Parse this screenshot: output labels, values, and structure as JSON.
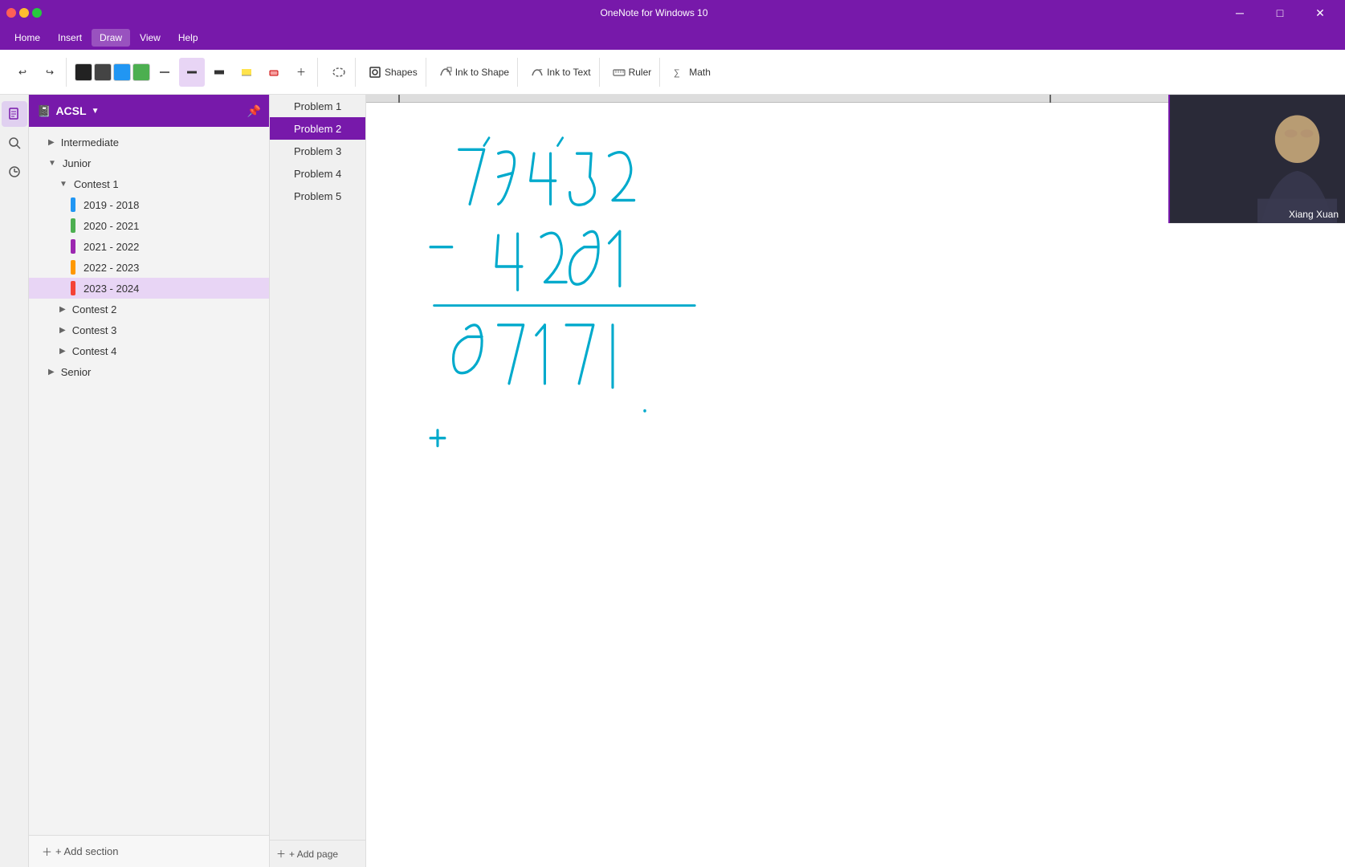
{
  "titleBar": {
    "title": "OneNote for Windows 10",
    "minimizeLabel": "─",
    "maximizeLabel": "□",
    "closeLabel": "✕"
  },
  "menuBar": {
    "items": [
      "Home",
      "Insert",
      "Draw",
      "View",
      "Help"
    ]
  },
  "toolbar": {
    "drawTab": "Draw",
    "shapesLabel": "Shapes",
    "inkToShapeLabel": "Ink to Shape",
    "inkToTextLabel": "Ink to Text",
    "rulerLabel": "Ruler",
    "mathLabel": "Math",
    "undoLabel": "↩",
    "redoLabel": "↪"
  },
  "sidebar": {
    "notebookName": "ACSL",
    "sections": [
      {
        "id": "intermediate",
        "label": "Intermediate",
        "expanded": false,
        "indent": 1
      },
      {
        "id": "junior",
        "label": "Junior",
        "expanded": true,
        "indent": 1,
        "children": [
          {
            "id": "contest1",
            "label": "Contest 1",
            "expanded": true,
            "indent": 2,
            "children": [
              {
                "id": "y2018",
                "label": "2019 - 2018",
                "color": "#2196F3",
                "indent": 3
              },
              {
                "id": "y2020",
                "label": "2020 - 2021",
                "color": "#4CAF50",
                "indent": 3
              },
              {
                "id": "y2021",
                "label": "2021 - 2022",
                "color": "#9C27B0",
                "indent": 3
              },
              {
                "id": "y2022",
                "label": "2022 - 2023",
                "color": "#FF9800",
                "indent": 3
              },
              {
                "id": "y2023",
                "label": "2023 - 2024",
                "color": "#F44336",
                "indent": 3,
                "active": true
              }
            ]
          },
          {
            "id": "contest2",
            "label": "Contest 2",
            "expanded": false,
            "indent": 2
          },
          {
            "id": "contest3",
            "label": "Contest 3",
            "expanded": false,
            "indent": 2
          },
          {
            "id": "contest4",
            "label": "Contest 4",
            "expanded": false,
            "indent": 2
          }
        ]
      },
      {
        "id": "senior",
        "label": "Senior",
        "expanded": false,
        "indent": 1
      }
    ],
    "pages": [
      "Problem 1",
      "Problem 2",
      "Problem 3",
      "Problem 4",
      "Problem 5"
    ],
    "activePage": "Problem 2",
    "addSectionLabel": "+ Add section",
    "addPageLabel": "+ Add page"
  },
  "webcam": {
    "personName": "Xiang Xuan"
  },
  "colors": {
    "purple": "#7719aa",
    "lightPurple": "#e8d5f5",
    "drawingColor": "#00AACC",
    "accent": "#7719aa"
  }
}
